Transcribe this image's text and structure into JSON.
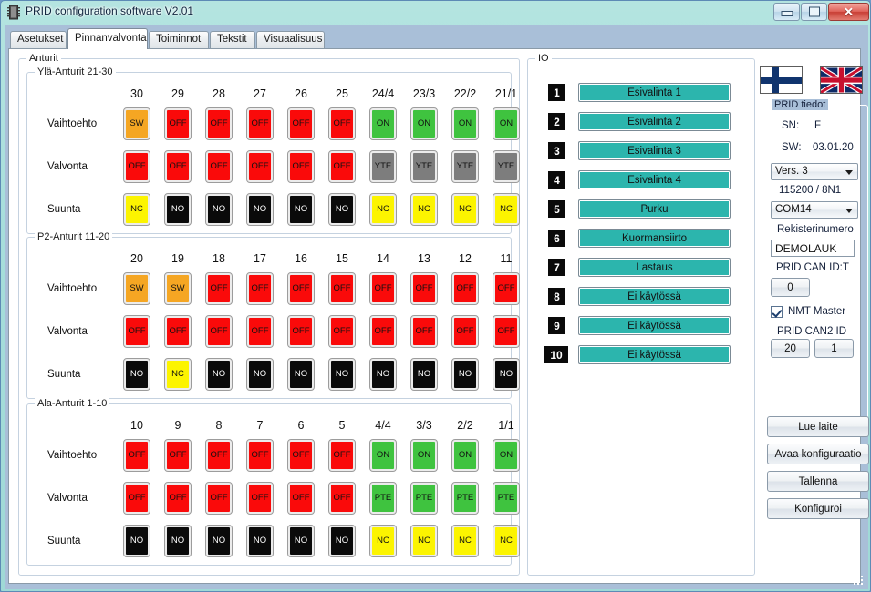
{
  "window": {
    "title": "PRID configuration software V2.01",
    "icon": "chip-icon",
    "minimize": "–",
    "maximize": "□",
    "close": "✕"
  },
  "tabs": [
    {
      "label": "Asetukset",
      "active": false
    },
    {
      "label": "Pinnanvalvonta",
      "active": true
    },
    {
      "label": "Toiminnot",
      "active": false
    },
    {
      "label": "Tekstit",
      "active": false
    },
    {
      "label": "Visuaalisuus",
      "active": false
    }
  ],
  "sensors": {
    "group_caption": "Anturit",
    "row_labels": [
      "Vaihtoehto",
      "Valvonta",
      "Suunta"
    ],
    "groups": [
      {
        "caption": "Ylä-Anturit 21-30",
        "columns": [
          "30",
          "29",
          "28",
          "27",
          "26",
          "25",
          "24/4",
          "23/3",
          "22/2",
          "21/1"
        ],
        "rows": [
          [
            {
              "text": "SW",
              "bg": "#f5a623",
              "fg": "#111111"
            },
            {
              "text": "OFF",
              "bg": "#fa0a0a",
              "fg": "#111111"
            },
            {
              "text": "OFF",
              "bg": "#fa0a0a",
              "fg": "#111111"
            },
            {
              "text": "OFF",
              "bg": "#fa0a0a",
              "fg": "#111111"
            },
            {
              "text": "OFF",
              "bg": "#fa0a0a",
              "fg": "#111111"
            },
            {
              "text": "OFF",
              "bg": "#fa0a0a",
              "fg": "#111111"
            },
            {
              "text": "ON",
              "bg": "#3fc33f",
              "fg": "#111111"
            },
            {
              "text": "ON",
              "bg": "#3fc33f",
              "fg": "#111111"
            },
            {
              "text": "ON",
              "bg": "#3fc33f",
              "fg": "#111111"
            },
            {
              "text": "ON",
              "bg": "#3fc33f",
              "fg": "#111111"
            }
          ],
          [
            {
              "text": "OFF",
              "bg": "#fa0a0a",
              "fg": "#111111"
            },
            {
              "text": "OFF",
              "bg": "#fa0a0a",
              "fg": "#111111"
            },
            {
              "text": "OFF",
              "bg": "#fa0a0a",
              "fg": "#111111"
            },
            {
              "text": "OFF",
              "bg": "#fa0a0a",
              "fg": "#111111"
            },
            {
              "text": "OFF",
              "bg": "#fa0a0a",
              "fg": "#111111"
            },
            {
              "text": "OFF",
              "bg": "#fa0a0a",
              "fg": "#111111"
            },
            {
              "text": "YTE",
              "bg": "#7d7d7d",
              "fg": "#111111"
            },
            {
              "text": "YTE",
              "bg": "#7d7d7d",
              "fg": "#111111"
            },
            {
              "text": "YTE",
              "bg": "#7d7d7d",
              "fg": "#111111"
            },
            {
              "text": "YTE",
              "bg": "#7d7d7d",
              "fg": "#111111"
            }
          ],
          [
            {
              "text": "NC",
              "bg": "#fcf400",
              "fg": "#111111"
            },
            {
              "text": "NO",
              "bg": "#0a0a0a",
              "fg": "#ffffff"
            },
            {
              "text": "NO",
              "bg": "#0a0a0a",
              "fg": "#ffffff"
            },
            {
              "text": "NO",
              "bg": "#0a0a0a",
              "fg": "#ffffff"
            },
            {
              "text": "NO",
              "bg": "#0a0a0a",
              "fg": "#ffffff"
            },
            {
              "text": "NO",
              "bg": "#0a0a0a",
              "fg": "#ffffff"
            },
            {
              "text": "NC",
              "bg": "#fcf400",
              "fg": "#111111"
            },
            {
              "text": "NC",
              "bg": "#fcf400",
              "fg": "#111111"
            },
            {
              "text": "NC",
              "bg": "#fcf400",
              "fg": "#111111"
            },
            {
              "text": "NC",
              "bg": "#fcf400",
              "fg": "#111111"
            }
          ]
        ]
      },
      {
        "caption": "P2-Anturit 11-20",
        "columns": [
          "20",
          "19",
          "18",
          "17",
          "16",
          "15",
          "14",
          "13",
          "12",
          "11"
        ],
        "rows": [
          [
            {
              "text": "SW",
              "bg": "#f5a623",
              "fg": "#111111"
            },
            {
              "text": "SW",
              "bg": "#f5a623",
              "fg": "#111111"
            },
            {
              "text": "OFF",
              "bg": "#fa0a0a",
              "fg": "#111111"
            },
            {
              "text": "OFF",
              "bg": "#fa0a0a",
              "fg": "#111111"
            },
            {
              "text": "OFF",
              "bg": "#fa0a0a",
              "fg": "#111111"
            },
            {
              "text": "OFF",
              "bg": "#fa0a0a",
              "fg": "#111111"
            },
            {
              "text": "OFF",
              "bg": "#fa0a0a",
              "fg": "#111111"
            },
            {
              "text": "OFF",
              "bg": "#fa0a0a",
              "fg": "#111111"
            },
            {
              "text": "OFF",
              "bg": "#fa0a0a",
              "fg": "#111111"
            },
            {
              "text": "OFF",
              "bg": "#fa0a0a",
              "fg": "#111111"
            }
          ],
          [
            {
              "text": "OFF",
              "bg": "#fa0a0a",
              "fg": "#111111"
            },
            {
              "text": "OFF",
              "bg": "#fa0a0a",
              "fg": "#111111"
            },
            {
              "text": "OFF",
              "bg": "#fa0a0a",
              "fg": "#111111"
            },
            {
              "text": "OFF",
              "bg": "#fa0a0a",
              "fg": "#111111"
            },
            {
              "text": "OFF",
              "bg": "#fa0a0a",
              "fg": "#111111"
            },
            {
              "text": "OFF",
              "bg": "#fa0a0a",
              "fg": "#111111"
            },
            {
              "text": "OFF",
              "bg": "#fa0a0a",
              "fg": "#111111"
            },
            {
              "text": "OFF",
              "bg": "#fa0a0a",
              "fg": "#111111"
            },
            {
              "text": "OFF",
              "bg": "#fa0a0a",
              "fg": "#111111"
            },
            {
              "text": "OFF",
              "bg": "#fa0a0a",
              "fg": "#111111"
            }
          ],
          [
            {
              "text": "NO",
              "bg": "#0a0a0a",
              "fg": "#ffffff"
            },
            {
              "text": "NC",
              "bg": "#fcf400",
              "fg": "#111111"
            },
            {
              "text": "NO",
              "bg": "#0a0a0a",
              "fg": "#ffffff"
            },
            {
              "text": "NO",
              "bg": "#0a0a0a",
              "fg": "#ffffff"
            },
            {
              "text": "NO",
              "bg": "#0a0a0a",
              "fg": "#ffffff"
            },
            {
              "text": "NO",
              "bg": "#0a0a0a",
              "fg": "#ffffff"
            },
            {
              "text": "NO",
              "bg": "#0a0a0a",
              "fg": "#ffffff"
            },
            {
              "text": "NO",
              "bg": "#0a0a0a",
              "fg": "#ffffff"
            },
            {
              "text": "NO",
              "bg": "#0a0a0a",
              "fg": "#ffffff"
            },
            {
              "text": "NO",
              "bg": "#0a0a0a",
              "fg": "#ffffff"
            }
          ]
        ]
      },
      {
        "caption": "Ala-Anturit 1-10",
        "columns": [
          "10",
          "9",
          "8",
          "7",
          "6",
          "5",
          "4/4",
          "3/3",
          "2/2",
          "1/1"
        ],
        "rows": [
          [
            {
              "text": "OFF",
              "bg": "#fa0a0a",
              "fg": "#111111"
            },
            {
              "text": "OFF",
              "bg": "#fa0a0a",
              "fg": "#111111"
            },
            {
              "text": "OFF",
              "bg": "#fa0a0a",
              "fg": "#111111"
            },
            {
              "text": "OFF",
              "bg": "#fa0a0a",
              "fg": "#111111"
            },
            {
              "text": "OFF",
              "bg": "#fa0a0a",
              "fg": "#111111"
            },
            {
              "text": "OFF",
              "bg": "#fa0a0a",
              "fg": "#111111"
            },
            {
              "text": "ON",
              "bg": "#3fc33f",
              "fg": "#111111"
            },
            {
              "text": "ON",
              "bg": "#3fc33f",
              "fg": "#111111"
            },
            {
              "text": "ON",
              "bg": "#3fc33f",
              "fg": "#111111"
            },
            {
              "text": "ON",
              "bg": "#3fc33f",
              "fg": "#111111"
            }
          ],
          [
            {
              "text": "OFF",
              "bg": "#fa0a0a",
              "fg": "#111111"
            },
            {
              "text": "OFF",
              "bg": "#fa0a0a",
              "fg": "#111111"
            },
            {
              "text": "OFF",
              "bg": "#fa0a0a",
              "fg": "#111111"
            },
            {
              "text": "OFF",
              "bg": "#fa0a0a",
              "fg": "#111111"
            },
            {
              "text": "OFF",
              "bg": "#fa0a0a",
              "fg": "#111111"
            },
            {
              "text": "OFF",
              "bg": "#fa0a0a",
              "fg": "#111111"
            },
            {
              "text": "PTE",
              "bg": "#3fc33f",
              "fg": "#111111"
            },
            {
              "text": "PTE",
              "bg": "#3fc33f",
              "fg": "#111111"
            },
            {
              "text": "PTE",
              "bg": "#3fc33f",
              "fg": "#111111"
            },
            {
              "text": "PTE",
              "bg": "#3fc33f",
              "fg": "#111111"
            }
          ],
          [
            {
              "text": "NO",
              "bg": "#0a0a0a",
              "fg": "#ffffff"
            },
            {
              "text": "NO",
              "bg": "#0a0a0a",
              "fg": "#ffffff"
            },
            {
              "text": "NO",
              "bg": "#0a0a0a",
              "fg": "#ffffff"
            },
            {
              "text": "NO",
              "bg": "#0a0a0a",
              "fg": "#ffffff"
            },
            {
              "text": "NO",
              "bg": "#0a0a0a",
              "fg": "#ffffff"
            },
            {
              "text": "NO",
              "bg": "#0a0a0a",
              "fg": "#ffffff"
            },
            {
              "text": "NC",
              "bg": "#fcf400",
              "fg": "#111111"
            },
            {
              "text": "NC",
              "bg": "#fcf400",
              "fg": "#111111"
            },
            {
              "text": "NC",
              "bg": "#fcf400",
              "fg": "#111111"
            },
            {
              "text": "NC",
              "bg": "#fcf400",
              "fg": "#111111"
            }
          ]
        ]
      }
    ]
  },
  "io": {
    "caption": "IO",
    "items": [
      {
        "num": "1",
        "label": "Esivalinta 1"
      },
      {
        "num": "2",
        "label": "Esivalinta 2"
      },
      {
        "num": "3",
        "label": "Esivalinta 3"
      },
      {
        "num": "4",
        "label": "Esivalinta 4"
      },
      {
        "num": "5",
        "label": "Purku"
      },
      {
        "num": "6",
        "label": "Kuormansiirto"
      },
      {
        "num": "7",
        "label": "Lastaus"
      },
      {
        "num": "8",
        "label": "Ei käytössä"
      },
      {
        "num": "9",
        "label": "Ei käytössä"
      },
      {
        "num": "10",
        "label": "Ei käytössä"
      }
    ],
    "button_color": "#2cb5ad"
  },
  "right_panel": {
    "flags": [
      {
        "name": "finland-flag"
      },
      {
        "name": "uk-flag"
      }
    ],
    "info_caption": "PRID tiedot",
    "sn_label": "SN:",
    "sn_value": "F",
    "sw_label": "SW:",
    "sw_value": "03.01.20",
    "version_select": "Vers. 3",
    "baud_text": "115200 / 8N1",
    "port_select": "COM14",
    "reg_label": "Rekisterinumero",
    "reg_value": "DEMOLAUK",
    "can_id_label": "PRID CAN ID:T",
    "can_id_value": "0",
    "nmt_master_label": "NMT Master",
    "nmt_master_checked": true,
    "can2_label": "PRID CAN2 ID",
    "can2_value_a": "20",
    "can2_value_b": "1",
    "actions": [
      {
        "label": "Lue laite"
      },
      {
        "label": "Avaa konfiguraatio"
      },
      {
        "label": "Tallenna"
      },
      {
        "label": "Konfiguroi"
      }
    ]
  }
}
